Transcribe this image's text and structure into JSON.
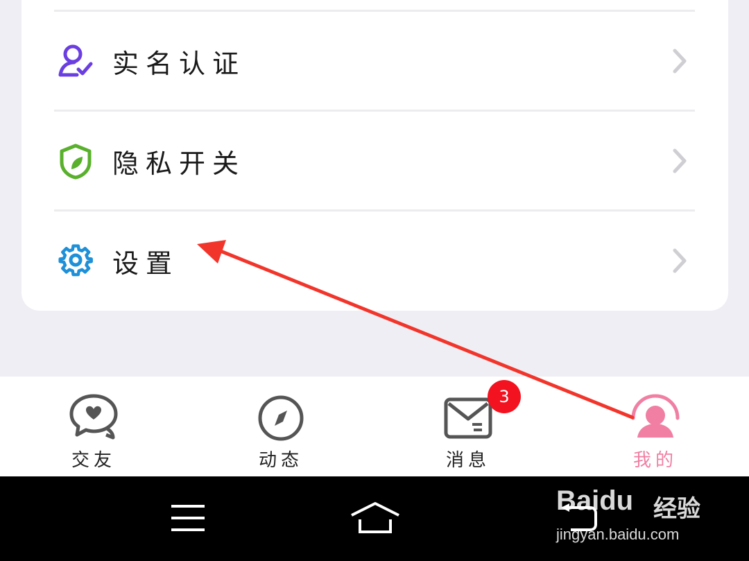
{
  "settings_list": {
    "items": [
      {
        "label": "实名认证",
        "icon": "verified-user-icon",
        "color": "#6a3ee0"
      },
      {
        "label": "隐私开关",
        "icon": "shield-icon",
        "color": "#59b02c"
      },
      {
        "label": "设置",
        "icon": "gear-icon",
        "color": "#1e90d8"
      }
    ]
  },
  "tabbar": {
    "tabs": [
      {
        "label": "交友",
        "icon": "chat-heart-icon",
        "active": false
      },
      {
        "label": "动态",
        "icon": "compass-icon",
        "active": false
      },
      {
        "label": "消息",
        "icon": "mail-icon",
        "active": false,
        "badge": "3"
      },
      {
        "label": "我的",
        "icon": "profile-icon",
        "active": true
      }
    ],
    "active_color": "#f07fa3"
  },
  "system_nav": {
    "buttons": [
      "menu-icon",
      "home-icon",
      "back-icon"
    ]
  },
  "watermark": {
    "brand": "Baidu",
    "brand_cn": "经验",
    "url": "jingyan.baidu.com"
  },
  "annotation": {
    "arrow_color": "#f2352b"
  }
}
